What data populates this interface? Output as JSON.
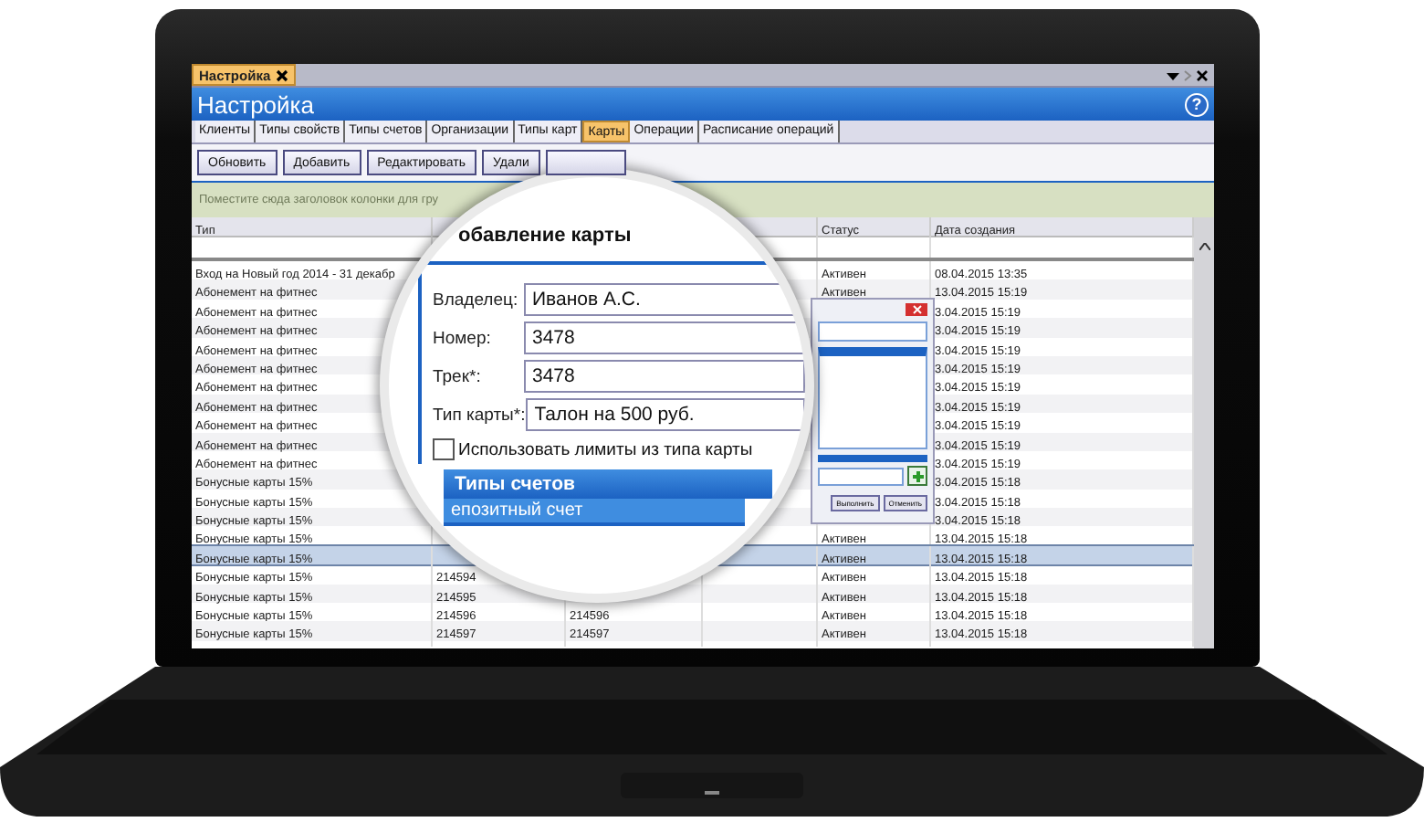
{
  "window": {
    "tab": "Настройка",
    "title": "Настройка",
    "help": "?"
  },
  "tabs": [
    {
      "label": "Клиенты",
      "selected": false
    },
    {
      "label": "Типы свойств",
      "selected": false
    },
    {
      "label": "Типы счетов",
      "selected": false
    },
    {
      "label": "Организации",
      "selected": false
    },
    {
      "label": "Типы карт",
      "selected": false
    },
    {
      "label": "Карты",
      "selected": true
    },
    {
      "label": "Операции",
      "selected": false
    },
    {
      "label": "Расписание операций",
      "selected": false
    }
  ],
  "toolbar": {
    "buttons": [
      "Обновить",
      "Добавить",
      "Редактировать",
      "Удали"
    ]
  },
  "group_panel": {
    "hint": "Поместите сюда заголовок колонки для гру"
  },
  "table": {
    "columns": {
      "type": "Тип",
      "status": "Статус",
      "created": "Дата создания"
    },
    "rows": [
      {
        "type": "Вход на Новый год 2014 - 31 декабр",
        "status": "Активен",
        "created": "08.04.2015 13:35",
        "selected": false
      },
      {
        "type": "Абонемент на фитнес",
        "status": "Активен",
        "created": "13.04.2015 15:19",
        "selected": false
      },
      {
        "type": "Абонемент на фитнес",
        "created": "3.04.2015 15:19",
        "selected": false
      },
      {
        "type": "Абонемент на фитнес",
        "created": "3.04.2015 15:19",
        "selected": false
      },
      {
        "type": "Абонемент на фитнес",
        "created": "3.04.2015 15:19",
        "selected": false
      },
      {
        "type": "Абонемент на фитнес",
        "created": "3.04.2015 15:19",
        "selected": false
      },
      {
        "type": "Абонемент на фитнес",
        "created": "3.04.2015 15:19",
        "selected": false
      },
      {
        "type": "Абонемент на фитнес",
        "created": "3.04.2015 15:19",
        "selected": false
      },
      {
        "type": "Абонемент на фитнес",
        "created": "3.04.2015 15:19",
        "selected": false
      },
      {
        "type": "Абонемент на фитнес",
        "created": "3.04.2015 15:19",
        "selected": false
      },
      {
        "type": "Абонемент на фитнес",
        "created": "3.04.2015 15:19",
        "selected": false
      },
      {
        "type": "Бонусные карты 15%",
        "created": "3.04.2015 15:18",
        "selected": false
      },
      {
        "type": "Бонусные карты 15%",
        "created": "3.04.2015 15:18",
        "selected": false
      },
      {
        "type": "Бонусные карты 15%",
        "created": "3.04.2015 15:18",
        "selected": false
      },
      {
        "type": "Бонусные карты 15%",
        "status": "Активен",
        "created": "13.04.2015 15:18",
        "selected": false
      },
      {
        "type": "Бонусные карты 15%",
        "status": "Активен",
        "created": "13.04.2015 15:18",
        "selected": true
      },
      {
        "type": "Бонусные карты 15%",
        "column_2": "214594",
        "status": "Активен",
        "created": "13.04.2015 15:18",
        "selected": false
      },
      {
        "type": "Бонусные карты 15%",
        "column_2": "214595",
        "status": "Активен",
        "created": "13.04.2015 15:18",
        "selected": false
      },
      {
        "type": "Бонусные карты 15%",
        "column_2": "214596",
        "column_3": "214596",
        "status": "Активен",
        "created": "13.04.2015 15:18",
        "selected": false
      },
      {
        "type": "Бонусные карты 15%",
        "column_2": "214597",
        "column_3": "214597",
        "status": "Активен",
        "created": "13.04.2015 15:18",
        "selected": false
      }
    ]
  },
  "background_dialog": {
    "buttons": [
      "Выполнить",
      "Отменить"
    ]
  },
  "dialog": {
    "title": "обавление карты",
    "fields": [
      {
        "label": "Владелец:",
        "value": "Иванов А.С."
      },
      {
        "label": "Номер:",
        "value": "3478"
      },
      {
        "label": "Трек*:",
        "value": "3478"
      },
      {
        "label": "Тип карты*:",
        "value": "Талон на 500 руб."
      }
    ],
    "checkbox": {
      "label": "Использовать лимиты из типа карты",
      "checked": false
    },
    "section": "Типы счетов",
    "accounts": [
      {
        "label": "епозитный счет",
        "selected": true
      }
    ]
  }
}
